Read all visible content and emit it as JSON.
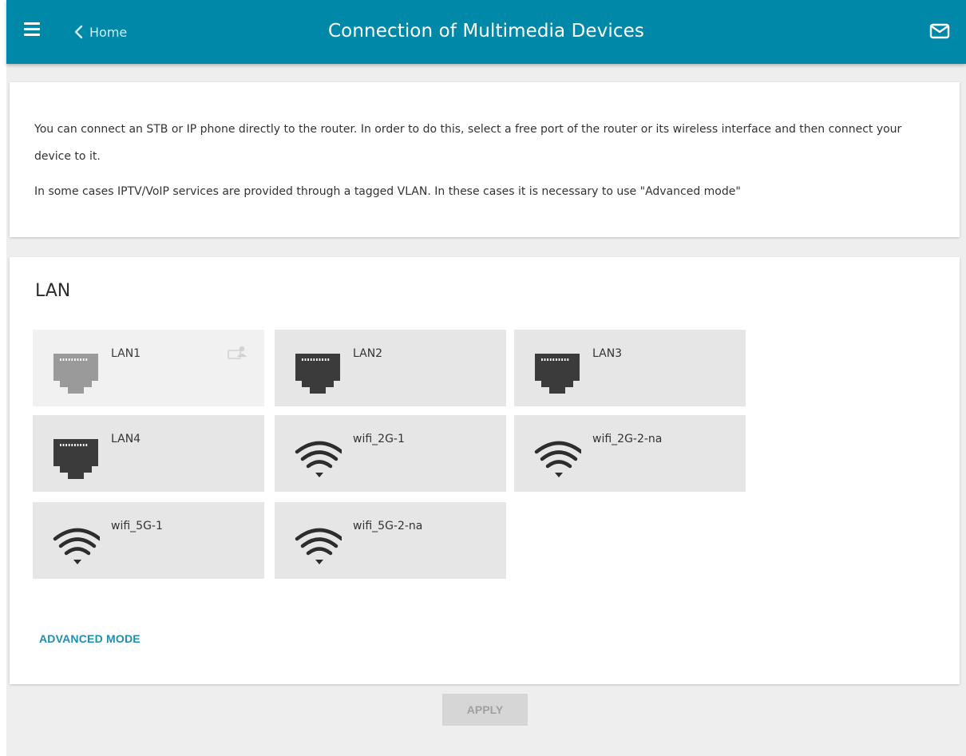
{
  "header": {
    "back_label": "Home",
    "title": "Connection of Multimedia Devices",
    "menu_icon": "hamburger-icon",
    "back_icon": "chevron-left-icon",
    "mail_icon": "envelope-icon",
    "accent_color": "#0088a8"
  },
  "info": {
    "paragraph1": "You can connect an STB or IP phone directly to the router. In order to do this, select a free port of the router or its wireless interface and then connect your device to it.",
    "paragraph2": "In some cases IPTV/VoIP services are provided through a tagged VLAN. In these cases it is necessary to use \"Advanced mode\""
  },
  "lan_section": {
    "title": "LAN",
    "interfaces": [
      {
        "label": "LAN1",
        "icon": "ethernet-port-icon",
        "disabled": true,
        "badge_icon": "connected-device-icon"
      },
      {
        "label": "LAN2",
        "icon": "ethernet-port-icon"
      },
      {
        "label": "LAN3",
        "icon": "ethernet-port-icon"
      },
      {
        "label": "LAN4",
        "icon": "ethernet-port-icon"
      },
      {
        "label": "wifi_2G-1",
        "icon": "wifi-icon"
      },
      {
        "label": "wifi_2G-2-na",
        "icon": "wifi-icon"
      },
      {
        "label": "wifi_5G-1",
        "icon": "wifi-icon"
      },
      {
        "label": "wifi_5G-2-na",
        "icon": "wifi-icon"
      }
    ],
    "advanced_mode_label": "ADVANCED MODE",
    "link_color": "#1d8fb3"
  },
  "footer": {
    "apply_label": "APPLY"
  }
}
